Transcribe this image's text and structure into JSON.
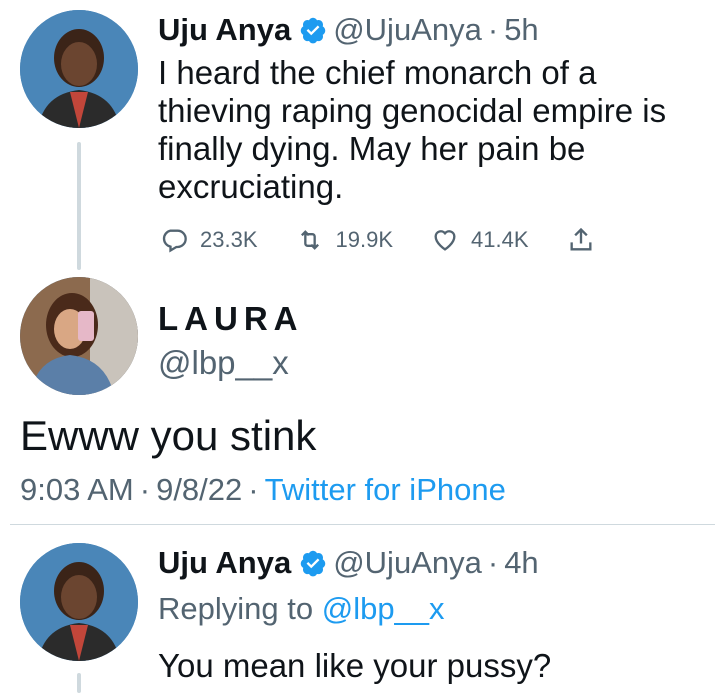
{
  "tweet1": {
    "name": "Uju Anya",
    "handle": "@UjuAnya",
    "separator": "·",
    "time": "5h",
    "text_lines": [
      "I heard the chief monarch of a",
      "thieving raping genocidal empire is",
      "finally dying. May her pain be",
      "excruciating."
    ],
    "replies": "23.3K",
    "retweets": "19.9K",
    "likes": "41.4K"
  },
  "tweet2": {
    "name": "LAURA",
    "handle": "@lbp__x",
    "text": "Ewww you stink",
    "time": "9:03 AM",
    "separator": "·",
    "date": "9/8/22",
    "source": "Twitter for iPhone"
  },
  "tweet3": {
    "name": "Uju Anya",
    "handle": "@UjuAnya",
    "separator": "·",
    "time": "4h",
    "replying_prefix": "Replying to",
    "replying_to": "@lbp__x",
    "text": "You mean like your pussy?"
  },
  "colors": {
    "verified": "#1d9bf0",
    "link": "#1d9bf0",
    "secondary": "#536471",
    "primary_text": "#0f1419"
  },
  "icons": [
    "reply-icon",
    "retweet-icon",
    "like-icon",
    "share-icon",
    "verified-badge-icon"
  ]
}
